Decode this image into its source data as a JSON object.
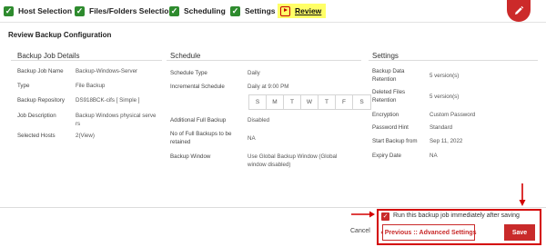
{
  "wizard": {
    "steps": [
      {
        "label": "Host Selection"
      },
      {
        "label": "Files/Folders Selection"
      },
      {
        "label": "Scheduling"
      },
      {
        "label": "Settings"
      },
      {
        "label": "Review"
      }
    ],
    "active_step": "Review"
  },
  "page_title": "Review Backup Configuration",
  "backup_job_details": {
    "heading": "Backup Job Details",
    "rows": [
      {
        "label": "Backup Job Name",
        "value": "Backup-Windows-Server"
      },
      {
        "label": "Type",
        "value": "File Backup"
      },
      {
        "label": "Backup Repository",
        "value": "DS918BCK-cifs [ Simple ]"
      },
      {
        "label": "Job Description",
        "value_line1": "Backup Windows physical serve",
        "value_line2": "rs"
      },
      {
        "label": "Selected Hosts",
        "count": "2",
        "link": "(View)"
      }
    ]
  },
  "schedule": {
    "heading": "Schedule",
    "schedule_type_label": "Schedule Type",
    "schedule_type_value": "Daily",
    "incremental_label": "Incremental Schedule",
    "incremental_value": "Daily at 9:00 PM",
    "days": [
      "S",
      "M",
      "T",
      "W",
      "T",
      "F",
      "S"
    ],
    "full_backup_label": "Additional Full Backup",
    "full_backup_value": "Disabled",
    "retained_label_line1": "No of Full Backups to be",
    "retained_label_line2": "retained",
    "retained_value": "NA",
    "window_label": "Backup Window",
    "window_value_line1": "Use Global Backup Window  (Global",
    "window_value_line2": "window disabled)"
  },
  "settings": {
    "heading": "Settings",
    "data_retention_label_line1": "Backup Data",
    "data_retention_label_line2": "Retention",
    "data_retention_value": "5 version(s)",
    "deleted_retention_label_line1": "Deleted Files",
    "deleted_retention_label_line2": "Retention",
    "deleted_retention_value": "5 version(s)",
    "encryption_label": "Encryption",
    "encryption_value": "Custom Password",
    "hint_label": "Password Hint",
    "hint_value": "Standard",
    "start_label": "Start Backup from",
    "start_value": "Sep 11, 2022",
    "expiry_label": "Expiry Date",
    "expiry_value": "NA"
  },
  "footer": {
    "cancel_label": "Cancel",
    "run_now_label": "Run this backup job immediately after saving",
    "run_now_checked": true,
    "previous_label": "‹ Previous :: Advanced Settings",
    "save_label": "Save"
  },
  "colors": {
    "accent": "#c92a2a",
    "step_done": "#2e8b2e",
    "active_step_bg": "#ffff66"
  }
}
